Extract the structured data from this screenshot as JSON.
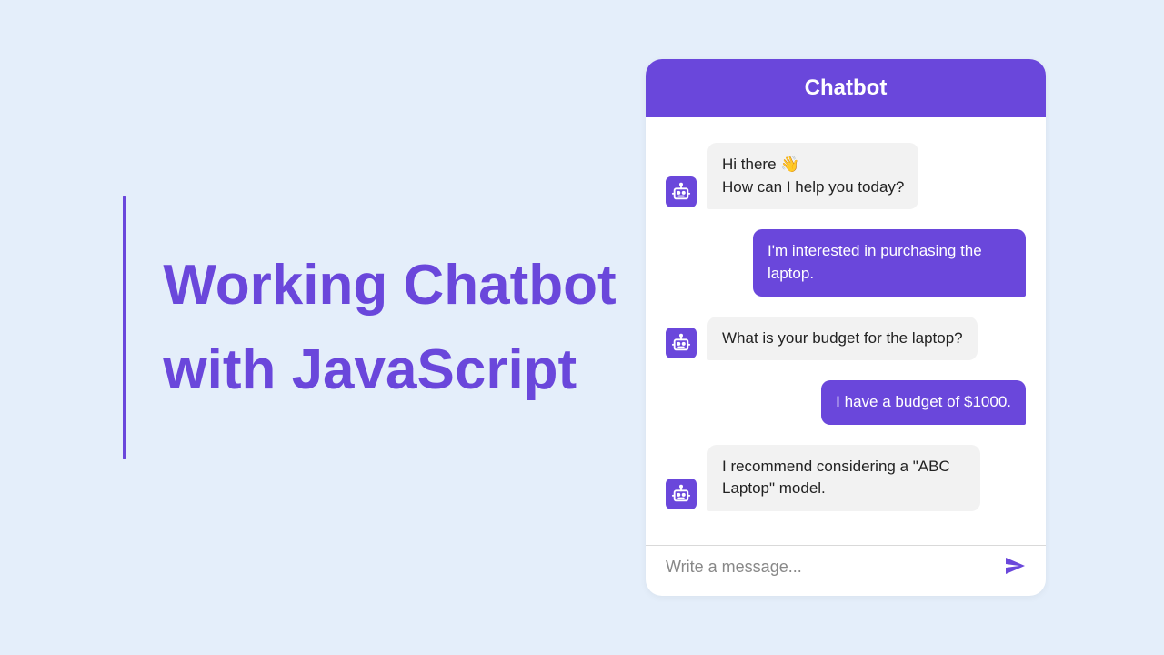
{
  "headline": "Working Chatbot with JavaScript",
  "chat": {
    "title": "Chatbot",
    "messages": [
      {
        "role": "bot",
        "text": "Hi there 👋\nHow can I help you today?"
      },
      {
        "role": "user",
        "text": "I'm interested in purchasing the laptop."
      },
      {
        "role": "bot",
        "text": "What is your budget for the laptop?"
      },
      {
        "role": "user",
        "text": "I have a budget of $1000."
      },
      {
        "role": "bot",
        "text": "I recommend considering a \"ABC Laptop\" model."
      }
    ],
    "input_placeholder": "Write a message...",
    "input_value": ""
  },
  "colors": {
    "accent": "#6a47db",
    "page_bg": "#e4eefa"
  }
}
